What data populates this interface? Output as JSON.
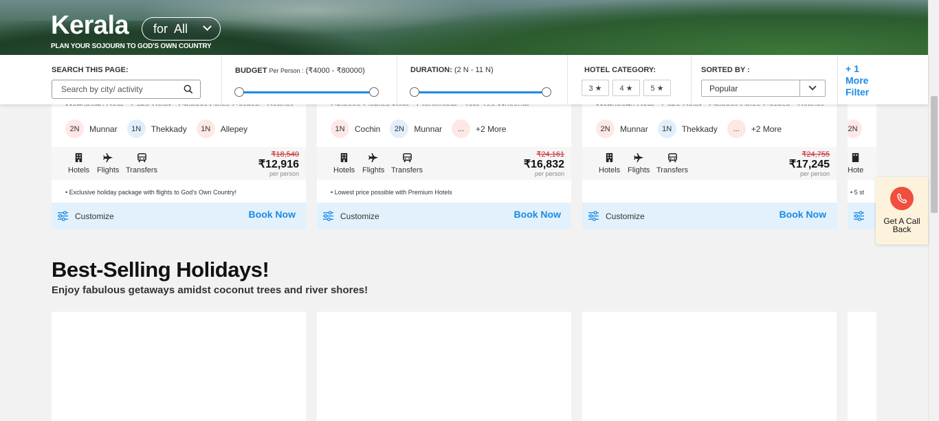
{
  "hero": {
    "title": "Kerala",
    "for_label": "for  All",
    "subtitle": "PLAN YOUR SOJOURN TO GOD'S OWN COUNTRY"
  },
  "filters": {
    "search_label": "SEARCH THIS PAGE:",
    "search_placeholder": "Search by city/ activity",
    "budget_label": "BUDGET",
    "budget_per": "Per Person :",
    "budget_range": "(₹4000 - ₹80000)",
    "duration_label": "DURATION:",
    "duration_range": "(2 N - 11 N)",
    "hotel_label": "HOTEL CATEGORY:",
    "hotel_options": [
      "3 ★",
      "4 ★",
      "5 ★"
    ],
    "sort_label": "SORTED BY :",
    "sort_value": "Popular",
    "more_filter": "+ 1 More Filter"
  },
  "packages": [
    {
      "route": "Mattupetty Dam · Echo Point · Chinnar Spice Garden · Periyar",
      "stops": [
        {
          "nights": "2N",
          "city": "Munnar",
          "color": "pink"
        },
        {
          "nights": "1N",
          "city": "Thekkady",
          "color": "blue"
        },
        {
          "nights": "1N",
          "city": "Allepey",
          "color": "pink"
        }
      ],
      "old_price": "₹18,540",
      "price": "₹12,916",
      "per": "per person",
      "note": "• Exclusive holiday package with flights to God's Own Country!"
    },
    {
      "route": "Chinese Fishing Nets · Eravikulam · Tata Tea Museum",
      "stops": [
        {
          "nights": "1N",
          "city": "Cochin",
          "color": "pink"
        },
        {
          "nights": "2N",
          "city": "Munnar",
          "color": "blue"
        },
        {
          "nights": "...",
          "city": "+2 More",
          "color": "pink"
        }
      ],
      "old_price": "₹24,161",
      "price": "₹16,832",
      "per": "per person",
      "note": "• Lowest price possible with Premium Hotels"
    },
    {
      "route": "Mattupetty Dam · Echo Point · Chinnar Spice Garden · Periyar",
      "stops": [
        {
          "nights": "2N",
          "city": "Munnar",
          "color": "pink"
        },
        {
          "nights": "1N",
          "city": "Thekkady",
          "color": "blue"
        },
        {
          "nights": "...",
          "city": "+2 More",
          "color": "pink"
        }
      ],
      "old_price": "₹24,755",
      "price": "₹17,245",
      "per": "per person",
      "note": ""
    }
  ],
  "partial_card": {
    "nights": "2N",
    "inc": "Hote",
    "note": "• 5 st"
  },
  "inclusions": {
    "hotels": "Hotels",
    "flights": "Flights",
    "transfers": "Transfers"
  },
  "card_actions": {
    "customize": "Customize",
    "book": "Book Now"
  },
  "section": {
    "title": "Best-Selling Holidays!",
    "subtitle": "Enjoy fabulous getaways amidst coconut trees and river shores!"
  },
  "callback": {
    "label": "Get A Call Back"
  },
  "colors": {
    "accent": "#1a8ae6",
    "call": "#f04e3e",
    "strike": "#c62828"
  }
}
